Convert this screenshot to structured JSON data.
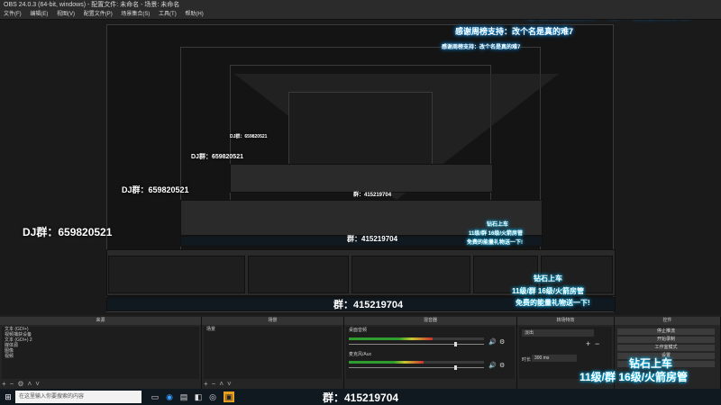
{
  "window": {
    "title": "OBS 24.0.3 (64-bit, windows) - 配置文件: 未命名 - 场景: 未命名"
  },
  "menu": [
    "文件(F)",
    "编辑(E)",
    "视图(V)",
    "配置文件(P)",
    "场景集合(S)",
    "工具(T)",
    "帮助(H)"
  ],
  "overlays": {
    "thanks": "感谢周榜支持：改个名是真的难7",
    "dj_group": "DJ群：659820521",
    "qun": "群：415219704",
    "diamond": "钻石上车",
    "levels": "11级/群 16级/火箭房管",
    "gift": "免费的能量礼物送一下!"
  },
  "docks": {
    "sources_title": "来源",
    "scenes_title": "场景",
    "mixer_title": "混音器",
    "transitions_title": "转场特效",
    "controls_title": "控件",
    "sources": [
      "文本 (GDI+)",
      "视频捕获设备",
      "文本 (GDI+) 2",
      "媒体源",
      "图像",
      "视频"
    ],
    "scene_item": "场景",
    "mixer": [
      {
        "name": "桌面音频",
        "level": 0.62
      },
      {
        "name": "麦克风/Aux",
        "level": 0.55
      }
    ],
    "transition_value": "淡出",
    "duration_label": "时长",
    "duration_value": "300 ms",
    "controls": [
      "停止推流",
      "开始录制",
      "工作室模式",
      "设置",
      "退出"
    ]
  },
  "taskbar": {
    "search_placeholder": "在这里输入你要搜索的内容"
  }
}
